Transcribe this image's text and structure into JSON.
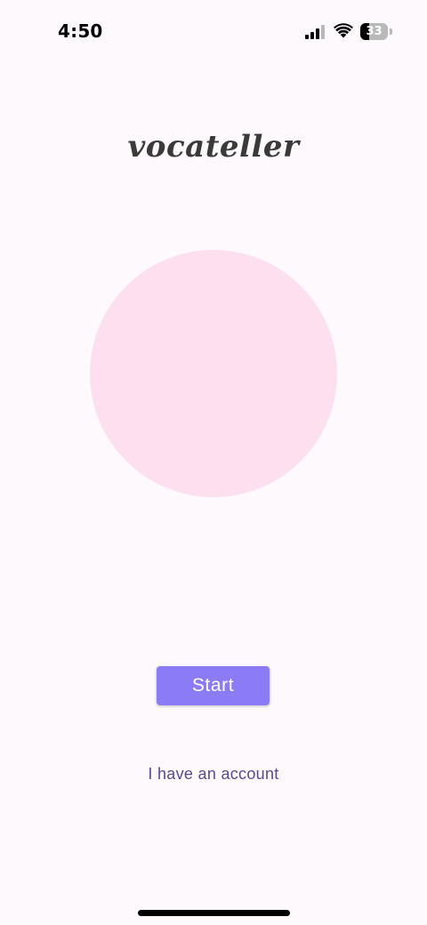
{
  "status_bar": {
    "time": "4:50",
    "battery_level": "33",
    "battery_fraction": 0.33,
    "icons": [
      "signal-icon",
      "wifi-icon",
      "battery-icon"
    ]
  },
  "app": {
    "title": "vocateller"
  },
  "actions": {
    "start_label": "Start",
    "account_link_label": "I have an account"
  },
  "colors": {
    "background": "#fdf9fd",
    "circle": "#fde0f0",
    "button_bg": "#8b7cf6",
    "link_text": "#5b4a8b",
    "title_text": "#3a3a3a"
  }
}
